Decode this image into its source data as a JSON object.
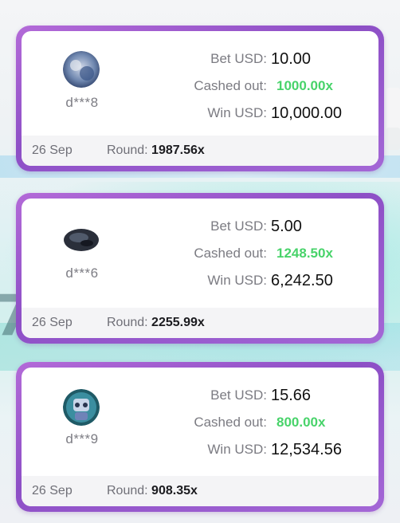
{
  "colors": {
    "card_border": "#9b5bd0",
    "cashed_out": "#48d36a",
    "label_gray": "#7b7b82",
    "value_dark": "#111111"
  },
  "labels": {
    "bet": "Bet USD:",
    "cashed_out": "Cashed out:",
    "win": "Win USD:",
    "round": "Round:"
  },
  "cards": [
    {
      "user": "d***8",
      "avatar": "avatar-icon",
      "bet": "10.00",
      "cashed_out": "1000.00x",
      "win": "10,000.00",
      "date": "26 Sep",
      "round": "1987.56x"
    },
    {
      "user": "d***6",
      "avatar": "avatar-icon",
      "bet": "5.00",
      "cashed_out": "1248.50x",
      "win": "6,242.50",
      "date": "26 Sep",
      "round": "2255.99x"
    },
    {
      "user": "d***9",
      "avatar": "avatar-icon",
      "bet": "15.66",
      "cashed_out": "800.00x",
      "win": "12,534.56",
      "date": "26 Sep",
      "round": "908.35x"
    }
  ]
}
